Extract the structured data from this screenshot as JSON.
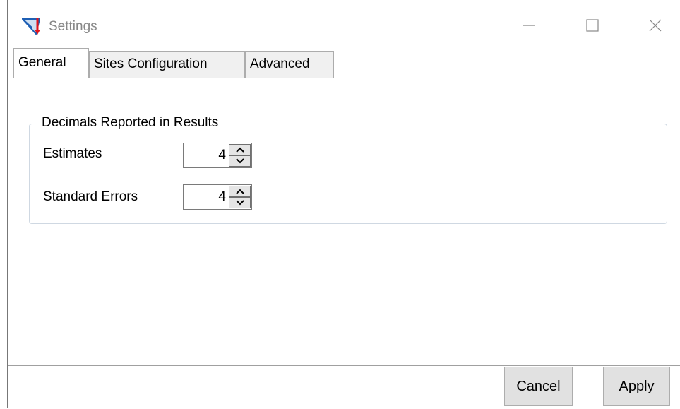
{
  "window": {
    "title": "Settings",
    "icon": "app-icon",
    "controls": {
      "minimize": "minimize-icon",
      "maximize": "maximize-icon",
      "close": "close-icon"
    }
  },
  "tabs": [
    {
      "label": "General",
      "active": true
    },
    {
      "label": "Sites Configuration",
      "active": false
    },
    {
      "label": "Advanced",
      "active": false
    }
  ],
  "decimals": {
    "legend": "Decimals Reported in Results",
    "estimates": {
      "label": "Estimates",
      "value": "4"
    },
    "standard_errors": {
      "label": "Standard Errors",
      "value": "4"
    }
  },
  "buttons": {
    "cancel": "Cancel",
    "apply": "Apply"
  },
  "colors": {
    "accent_blue": "#1e5fb4",
    "accent_red": "#e3141b"
  }
}
